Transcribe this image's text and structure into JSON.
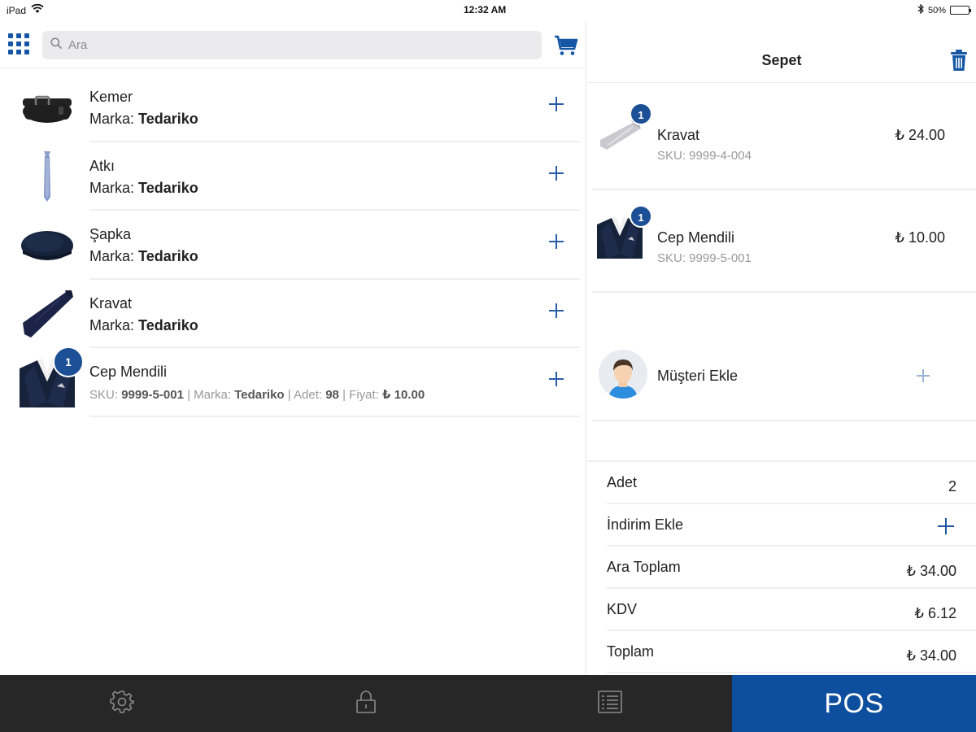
{
  "status_bar": {
    "device": "iPad",
    "time": "12:32 AM",
    "battery": "50%",
    "battery_level": 0.5
  },
  "search": {
    "placeholder": "Ara",
    "value": ""
  },
  "icons": {
    "grid": "apps-grid-icon",
    "search": "search-icon",
    "cart": "cart-icon",
    "trash": "trash-icon",
    "settings": "gear-icon",
    "lock": "lock-icon",
    "list": "list-icon"
  },
  "colors": {
    "accent": "#1556a5",
    "badge": "#1c4f96",
    "tabbar": "#272727",
    "pos_tab": "#0d4f9e"
  },
  "products": [
    {
      "name": "Kemer",
      "brand_label": "Marka:",
      "brand": "Tedariko"
    },
    {
      "name": "Atkı",
      "brand_label": "Marka:",
      "brand": "Tedariko"
    },
    {
      "name": "Şapka",
      "brand_label": "Marka:",
      "brand": "Tedariko"
    },
    {
      "name": "Kravat",
      "brand_label": "Marka:",
      "brand": "Tedariko"
    },
    {
      "name": "Cep Mendili",
      "badge": "1",
      "sku_label": "SKU:",
      "sku": "9999-5-001",
      "sep": "|",
      "brand_label": "Marka:",
      "brand": "Tedariko",
      "qty_label": "Adet:",
      "qty": "98",
      "price_label": "Fiyat:",
      "price": "₺ 10.00"
    }
  ],
  "cart": {
    "title": "Sepet",
    "items": [
      {
        "name": "Kravat",
        "sku": "SKU: 9999-4-004",
        "price": "₺ 24.00",
        "badge": "1"
      },
      {
        "name": "Cep Mendili",
        "sku": "SKU: 9999-5-001",
        "price": "₺ 10.00",
        "badge": "1"
      }
    ],
    "customer_label": "Müşteri Ekle",
    "summary": {
      "count_label": "Adet",
      "count": "2",
      "discount_label": "İndirim Ekle",
      "subtotal_label": "Ara Toplam",
      "subtotal": "₺ 34.00",
      "tax_label": "KDV",
      "tax": "₺ 6.12",
      "total_label": "Toplam",
      "total": "₺ 34.00"
    }
  },
  "tabs": {
    "pos_label": "POS"
  }
}
